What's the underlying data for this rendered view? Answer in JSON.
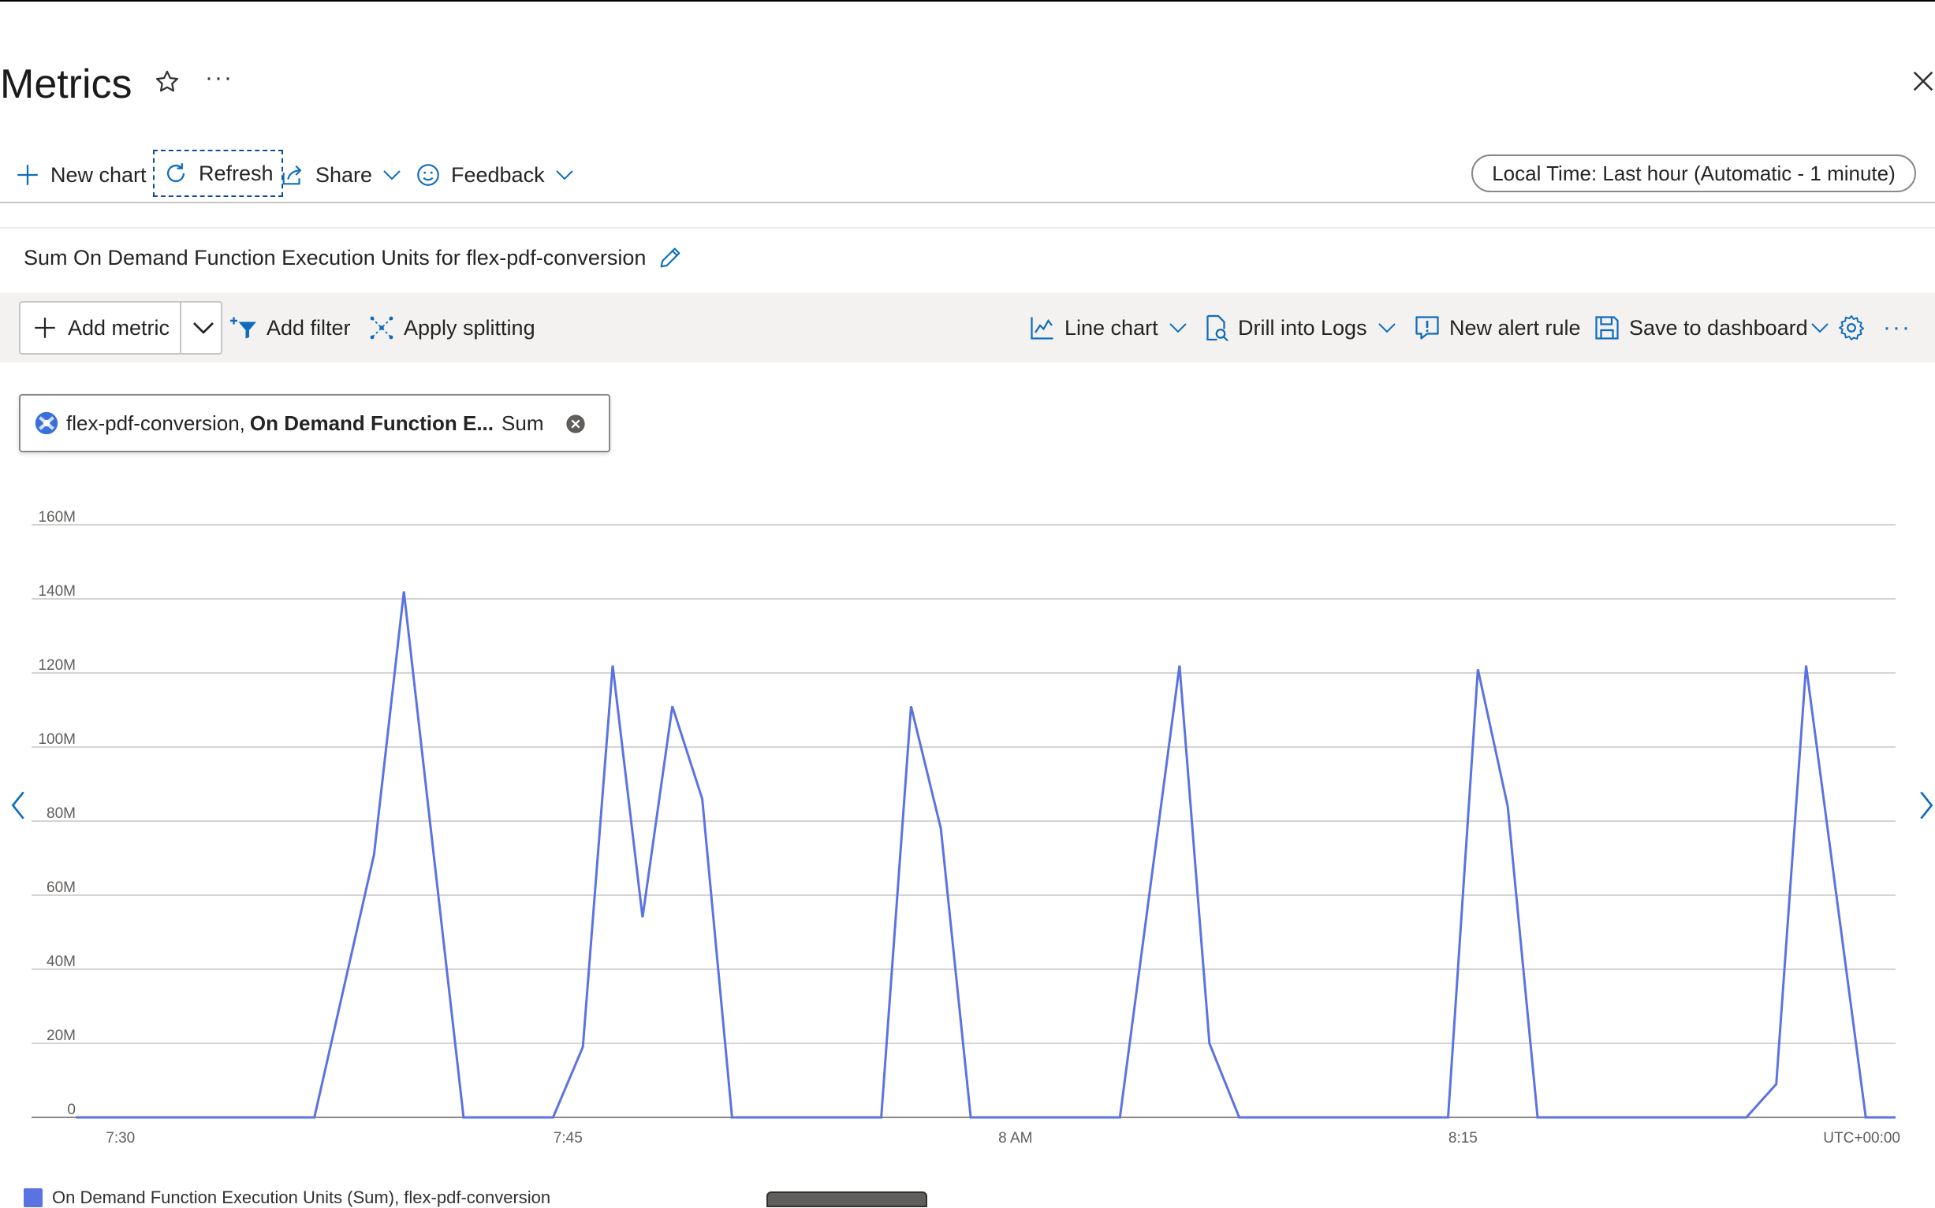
{
  "page": {
    "title": "Metrics",
    "star_icon": "star-outline-icon",
    "more_icon": "ellipsis-icon",
    "more_label": "···",
    "close_icon": "close-icon"
  },
  "commandbar": {
    "new_chart": "New chart",
    "refresh": "Refresh",
    "share": "Share",
    "feedback": "Feedback",
    "time_range": "Local Time: Last hour (Automatic - 1 minute)"
  },
  "chart": {
    "title": "Sum On Demand Function Execution Units for flex-pdf-conversion",
    "toolbar": {
      "add_metric": "Add metric",
      "add_filter": "Add filter",
      "apply_splitting": "Apply splitting",
      "line_chart": "Line chart",
      "drill_into_logs": "Drill into Logs",
      "new_alert_rule": "New alert rule",
      "save_to_dashboard": "Save to dashboard",
      "more_label": "···"
    },
    "metric_pill": {
      "resource": "flex-pdf-conversion,",
      "metric": "On Demand Function E...",
      "aggregation": "Sum"
    },
    "timezone_label": "UTC+00:00"
  },
  "colors": {
    "accent": "#0f6cbd",
    "series": "#5b73e2",
    "toolbar_bg": "#f3f2f1"
  },
  "chart_data": {
    "type": "line",
    "ylim": [
      0,
      160
    ],
    "y_unit": "M",
    "y_ticks": [
      "0",
      "20M",
      "40M",
      "60M",
      "80M",
      "100M",
      "120M",
      "140M",
      "160M"
    ],
    "x_ticks": [
      {
        "label": "7:30",
        "t": 1.5
      },
      {
        "label": "7:45",
        "t": 16.5
      },
      {
        "label": "8 AM",
        "t": 31.5
      },
      {
        "label": "8:15",
        "t": 46.5
      }
    ],
    "grid": true,
    "series": [
      {
        "values": [
          0,
          0,
          0,
          0,
          0,
          0,
          0,
          0,
          0,
          0,
          0,
          0,
          0,
          0,
          0,
          0,
          0,
          0,
          0,
          0,
          0,
          0,
          0,
          0,
          0,
          0,
          0,
          0,
          0,
          0,
          0,
          0,
          0,
          0,
          0,
          0,
          0,
          0,
          0,
          0,
          0,
          0,
          0,
          0,
          0,
          0,
          0,
          0,
          0,
          0,
          0,
          0,
          0,
          0,
          0,
          0,
          0,
          0,
          0,
          0,
          0
        ],
        "points": [
          [
            0,
            0
          ],
          [
            8,
            0
          ],
          [
            10,
            71
          ],
          [
            11,
            142
          ],
          [
            12,
            71
          ],
          [
            13,
            0
          ],
          [
            15,
            0
          ],
          [
            16,
            0
          ],
          [
            17,
            19
          ],
          [
            18,
            122
          ],
          [
            19,
            54
          ],
          [
            20,
            111
          ],
          [
            21,
            86
          ],
          [
            22,
            0
          ],
          [
            25,
            0
          ],
          [
            27,
            0
          ],
          [
            28,
            111
          ],
          [
            29,
            78
          ],
          [
            30,
            0
          ],
          [
            33,
            0
          ],
          [
            35,
            0
          ],
          [
            36,
            61
          ],
          [
            37,
            122
          ],
          [
            38,
            20
          ],
          [
            39,
            0
          ],
          [
            42,
            0
          ],
          [
            46,
            0
          ],
          [
            47,
            121
          ],
          [
            48,
            84
          ],
          [
            49,
            0
          ],
          [
            52,
            0
          ],
          [
            56,
            0
          ],
          [
            57,
            9
          ],
          [
            58,
            122
          ],
          [
            59,
            61
          ],
          [
            60,
            0
          ],
          [
            61,
            0
          ]
        ]
      }
    ]
  },
  "legend": {
    "label": "On Demand Function Execution Units (Sum), flex-pdf-conversion"
  }
}
